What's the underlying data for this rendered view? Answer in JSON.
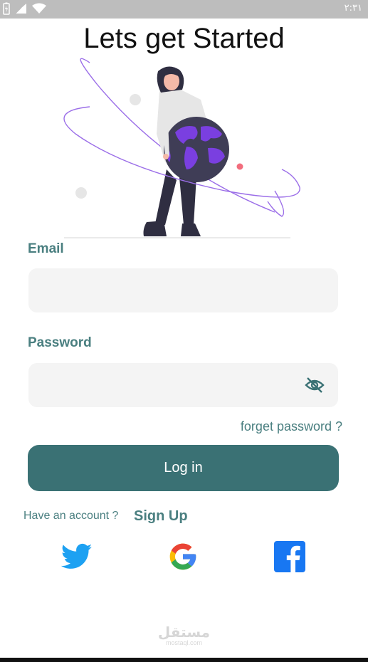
{
  "status_bar": {
    "time": "٢:٣١"
  },
  "title": "Lets get Started",
  "email": {
    "label": "Email",
    "value": "",
    "placeholder": ""
  },
  "password": {
    "label": "Password",
    "value": "",
    "placeholder": ""
  },
  "forget_password": "forget password ?",
  "login_button": "Log in",
  "have_account": "Have an account ?",
  "sign_up": "Sign Up",
  "social": [
    {
      "name": "twitter",
      "icon": "twitter-icon",
      "color": "#1da1f2"
    },
    {
      "name": "google",
      "icon": "google-icon",
      "color": "#4285f4"
    },
    {
      "name": "facebook",
      "icon": "facebook-icon",
      "color": "#1877f2"
    }
  ],
  "watermark": {
    "main": "مستقل",
    "sub": "mostaql.com"
  },
  "colors": {
    "accent": "#3a7174",
    "label": "#4a7f80",
    "input_bg": "#f4f4f4"
  }
}
